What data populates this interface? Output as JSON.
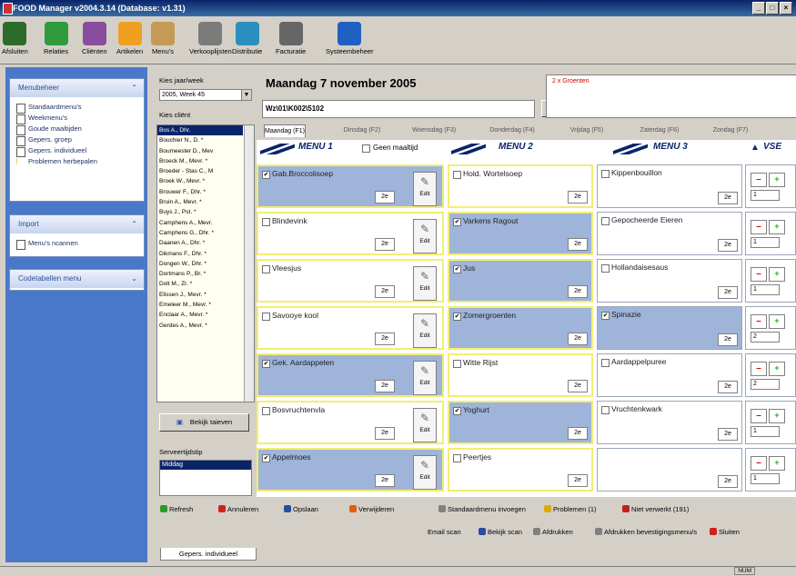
{
  "window": {
    "title": "FOOD Manager v2004.3.14  (Database: v1.31)",
    "controls": [
      "_",
      "□",
      "×"
    ]
  },
  "toolbar": [
    {
      "label": "Afsluiten",
      "icon": "exit-door-icon",
      "color": "#2d6b2a"
    },
    {
      "label": "Relaties",
      "icon": "relations-icon",
      "color": "#2f9b3d"
    },
    {
      "label": "Cliënten",
      "icon": "clients-icon",
      "color": "#8a4c9e"
    },
    {
      "label": "Artikelen",
      "icon": "articles-box-icon",
      "color": "#f0a020"
    },
    {
      "label": "Menu's",
      "icon": "menus-pencil-icon",
      "color": "#c49a55"
    },
    {
      "label": "Verkooplijsten",
      "icon": "sales-lists-icon",
      "color": "#7b7b7b"
    },
    {
      "label": "Distributie",
      "icon": "distribution-icon",
      "color": "#2a8fbf"
    },
    {
      "label": "Facturatie",
      "icon": "invoicing-pen-icon",
      "color": "#666666"
    },
    {
      "label": "Systeembeheer",
      "icon": "system-admin-icon",
      "color": "#2060c0"
    }
  ],
  "sidebar": {
    "groups": [
      {
        "title": "Menubeheer",
        "items": [
          {
            "label": "Standaardmenu's",
            "icon": "document-icon"
          },
          {
            "label": "Weekmenu's",
            "icon": "document-icon"
          },
          {
            "label": "Goude maaltijden",
            "icon": "document-icon"
          },
          {
            "label": "Gepers. groep",
            "icon": "document-icon"
          },
          {
            "label": "Gepers. individueel",
            "icon": "document-icon"
          },
          {
            "label": "Problemen herbepalen",
            "icon": "warning-icon"
          }
        ]
      },
      {
        "title": "Import",
        "items": [
          {
            "label": "Menu's ncannen",
            "icon": "document-icon"
          }
        ]
      },
      {
        "title": "Codetabellen menu",
        "items": []
      }
    ]
  },
  "client_panel": {
    "year_week_label": "Kies jaar/week",
    "year_week_value": "2005, Week  45",
    "client_label": "Kies cliënt",
    "clients": [
      "Bos A., Dhr.",
      "Bouchier N., D. *",
      "Boumeester D., Mev",
      "Broeck M., Mevr. *",
      "Broeder - Stas C., M",
      "Broek W., Mevr. *",
      "Brouwer F., Dhr. *",
      "Bruin A., Mevr. *",
      "Buys J., Pst. *",
      "Camphens A., Mevr.",
      "Camphens G., Dhr. *",
      "Daanen A., Dhr. *",
      "Dikmans F., Dhr. *",
      "Dongen W., Dhr. *",
      "Dortmans P., Br. *",
      "Dolt M., Zr. *",
      "Elissen J., Mevr. *",
      "Emeleer M., Mevr. *",
      "Enclaar A., Mevr. *",
      "Gerdes A., Mevr. *"
    ],
    "selected_client": "Bos A., Dhr.",
    "view_button": "Bekijk taieven",
    "serve_time_label": "Serveertijdstip",
    "serve_time_value": "Middag"
  },
  "header": {
    "date": "Maandag 7 november 2005",
    "client_code": "Wz\\01\\K002\\5102",
    "note_text": "2 x Groenten"
  },
  "day_tabs": [
    {
      "label": "Maandag (F1)",
      "active": true
    },
    {
      "label": "Dinsdag (F2)",
      "active": false
    },
    {
      "label": "Woensdag (F3)",
      "active": false
    },
    {
      "label": "Donderdag (F4)",
      "active": false
    },
    {
      "label": "Vrijdag (F5)",
      "active": false
    },
    {
      "label": "Zaterdag (F6)",
      "active": false
    },
    {
      "label": "Zondag (F7)",
      "active": false
    }
  ],
  "menu_columns": [
    {
      "title": "MENU 1"
    },
    {
      "title": "MENU 2"
    },
    {
      "title": "MENU 3"
    },
    {
      "title": "VSE"
    }
  ],
  "geen_maaltijd_label": "Geen maaltijd",
  "ze_label": "2e",
  "edit_label": "Edit",
  "rows": [
    {
      "cells": [
        {
          "name": "Gab.Broccolisoep",
          "checked": true,
          "hl": true,
          "edit": true
        },
        {
          "name": "Hold. Wortelsoep",
          "checked": false,
          "hl": false,
          "edit": false
        },
        {
          "name": "Kippenbouillon",
          "checked": false,
          "hl": false,
          "edit": false
        }
      ],
      "vse": "1"
    },
    {
      "cells": [
        {
          "name": "Blindevink",
          "checked": false,
          "hl": false,
          "edit": true
        },
        {
          "name": "Varkens Ragout",
          "checked": true,
          "hl": true,
          "edit": false
        },
        {
          "name": "Gepocheerde Eieren",
          "checked": false,
          "hl": false,
          "edit": false
        }
      ],
      "vse": "1"
    },
    {
      "cells": [
        {
          "name": "Vleesjus",
          "checked": false,
          "hl": false,
          "edit": true
        },
        {
          "name": "Jus",
          "checked": true,
          "hl": true,
          "edit": false
        },
        {
          "name": "Hollandaisesaus",
          "checked": false,
          "hl": false,
          "edit": false
        }
      ],
      "vse": "1"
    },
    {
      "cells": [
        {
          "name": "Savooye kool",
          "checked": false,
          "hl": false,
          "edit": true
        },
        {
          "name": "Zomergroenten",
          "checked": true,
          "hl": true,
          "edit": false
        },
        {
          "name": "Spinazie",
          "checked": true,
          "hl": true,
          "edit": false
        }
      ],
      "vse": "2"
    },
    {
      "cells": [
        {
          "name": "Gek. Aardappelen",
          "checked": true,
          "hl": true,
          "edit": true
        },
        {
          "name": "Witte Rijst",
          "checked": false,
          "hl": false,
          "edit": false
        },
        {
          "name": "Aardappelpuree",
          "checked": false,
          "hl": false,
          "edit": false
        }
      ],
      "vse": "2"
    },
    {
      "cells": [
        {
          "name": "Bosvruchtenvla",
          "checked": false,
          "hl": false,
          "edit": true
        },
        {
          "name": "Yoghurt",
          "checked": true,
          "hl": true,
          "edit": false
        },
        {
          "name": "Vruchtenkwark",
          "checked": false,
          "hl": false,
          "edit": false
        }
      ],
      "vse": "1"
    },
    {
      "cells": [
        {
          "name": "Appelmoes",
          "checked": true,
          "hl": true,
          "edit": true
        },
        {
          "name": "Peertjes",
          "checked": false,
          "hl": false,
          "edit": false
        },
        {
          "name": "",
          "checked": false,
          "hl": false,
          "edit": false
        }
      ],
      "vse": "1"
    }
  ],
  "actions": [
    {
      "label": "Refresh",
      "icon": "refresh-icon",
      "color": "#2a9a2a"
    },
    {
      "label": "Annuleren",
      "icon": "cancel-icon",
      "color": "#d02020"
    },
    {
      "label": "Opslaan",
      "icon": "save-icon",
      "color": "#2a4ca0"
    },
    {
      "label": "Verwijderen",
      "icon": "delete-icon",
      "color": "#e06010"
    },
    {
      "label": "Standaardmenu invoegen",
      "icon": "insert-menu-icon",
      "color": "#808080"
    },
    {
      "label": "Problemen (1)",
      "icon": "problems-warning-icon",
      "color": "#e0a800"
    },
    {
      "label": "Niet verwerkt (191)",
      "icon": "unprocessed-icon",
      "color": "#c02020"
    }
  ],
  "actions2": [
    {
      "label": "Email scan",
      "icon": "",
      "color": "#d4d0c8"
    },
    {
      "label": "Bekijk scan",
      "icon": "view-scan-icon",
      "color": "#2a4ca0"
    },
    {
      "label": "Afdrukken",
      "icon": "print-icon",
      "color": "#808080"
    },
    {
      "label": "Afdrukken bevestigingsmenu/s",
      "icon": "print-confirm-icon",
      "color": "#808080"
    },
    {
      "label": "Sluiten",
      "icon": "close-circle-icon",
      "color": "#d02020"
    }
  ],
  "bottom_tab": "Gepers. individueel",
  "status": {
    "num": "NUM"
  }
}
